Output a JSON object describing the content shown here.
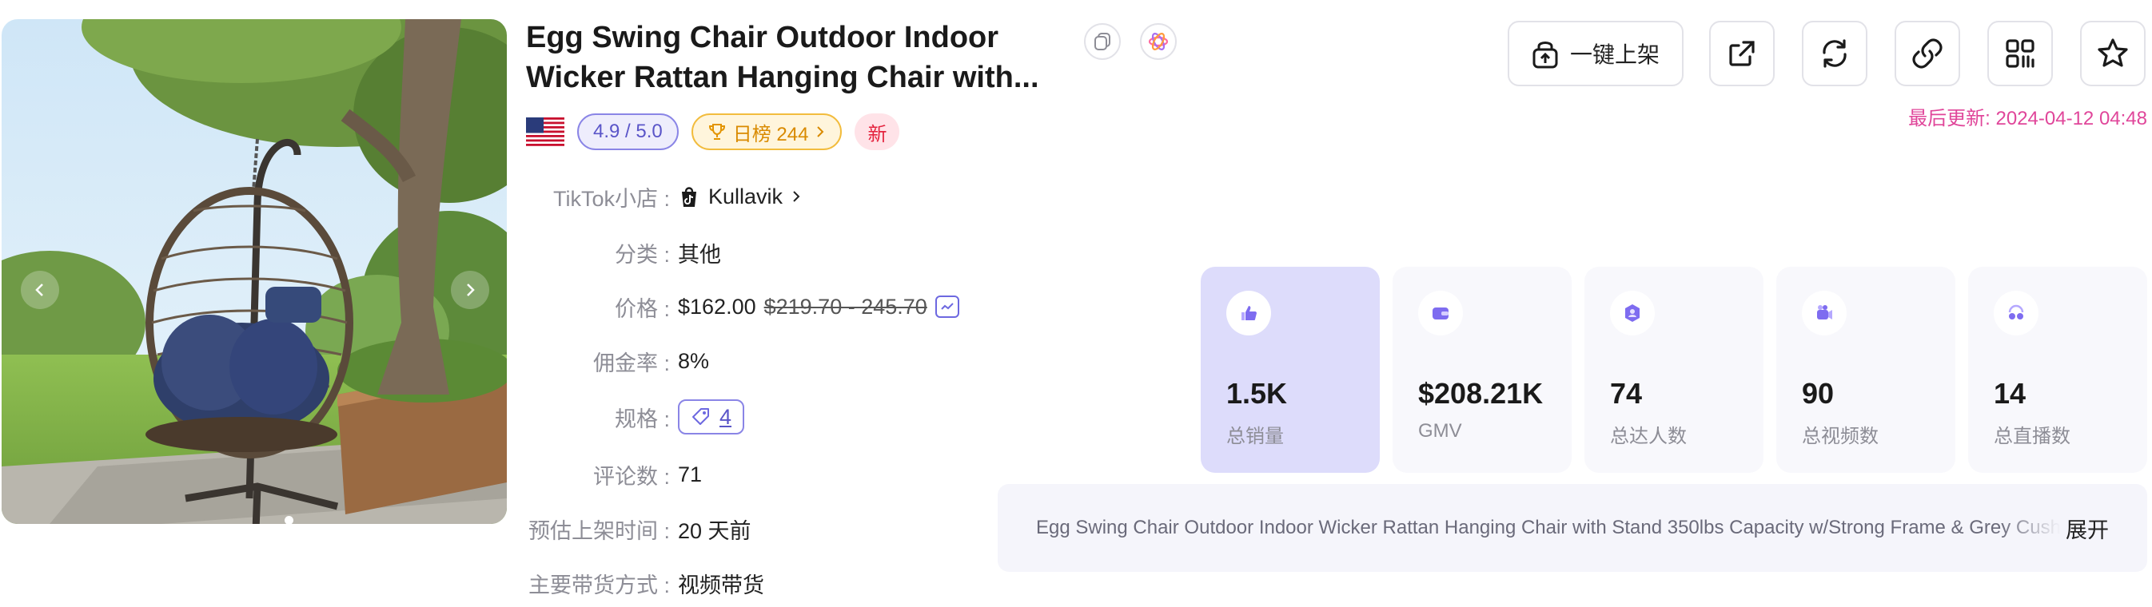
{
  "product": {
    "title_line1": "Egg Swing Chair Outdoor Indoor",
    "title_line2": "Wicker Rattan Hanging Chair with...",
    "rating": "4.9 / 5.0",
    "rank": "日榜 244",
    "new_badge": "新",
    "country_icon": "us-flag-icon"
  },
  "info": {
    "shop": {
      "label": "TikTok小店",
      "value": "Kullavik"
    },
    "category": {
      "label": "分类",
      "value": "其他"
    },
    "price": {
      "label": "价格",
      "current": "$162.00",
      "original": "$219.70 - 245.70"
    },
    "commission": {
      "label": "佣金率",
      "value": "8%"
    },
    "specs": {
      "label": "规格",
      "value": "4"
    },
    "reviews": {
      "label": "评论数",
      "value": "71"
    },
    "listed": {
      "label": "预估上架时间",
      "value": "20 天前"
    },
    "sales_mode": {
      "label": "主要带货方式",
      "value": "视频带货"
    }
  },
  "actions": {
    "list_label": "一键上架",
    "icons": [
      "upload-lock-icon",
      "external-link-icon",
      "refresh-icon",
      "link-icon",
      "qr-code-icon",
      "star-icon"
    ]
  },
  "updated": "最后更新: 2024-04-12 04:48",
  "stats": [
    {
      "value": "1.5K",
      "label": "总销量",
      "icon": "thumbs-up-icon"
    },
    {
      "value": "$208.21K",
      "label": "GMV",
      "icon": "wallet-icon"
    },
    {
      "value": "74",
      "label": "总达人数",
      "icon": "creator-icon"
    },
    {
      "value": "90",
      "label": "总视频数",
      "icon": "video-icon"
    },
    {
      "value": "14",
      "label": "总直播数",
      "icon": "live-icon"
    }
  ],
  "description": {
    "text": "Egg Swing Chair Outdoor Indoor Wicker Rattan Hanging Chair with Stand 350lbs Capacity w/Strong Frame & Grey Cushion",
    "expand_label": "展开"
  },
  "colors": {
    "accent": "#6d68e0",
    "active_card": "#dddcfb",
    "updated_text": "#e0469a",
    "rank_badge": "#d98a00",
    "new_badge": "#e4233e"
  }
}
